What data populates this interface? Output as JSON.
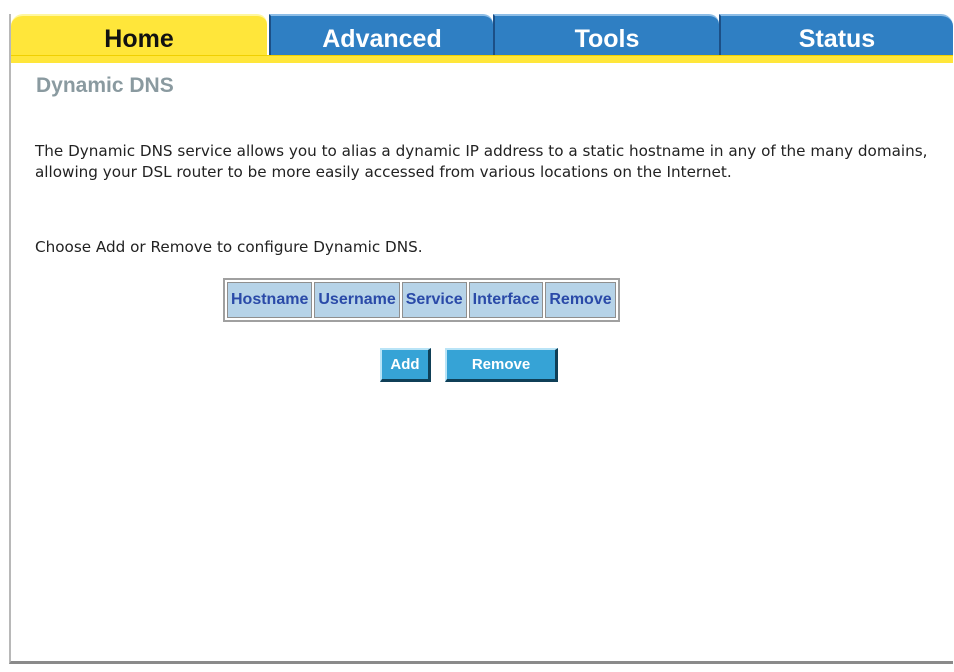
{
  "nav": {
    "tabs": [
      {
        "label": "Home",
        "active": true
      },
      {
        "label": "Advanced",
        "active": false
      },
      {
        "label": "Tools",
        "active": false
      },
      {
        "label": "Status",
        "active": false
      }
    ]
  },
  "page": {
    "title": "Dynamic DNS",
    "description": "The Dynamic DNS service allows you to alias a dynamic IP address to a static hostname in any of the many domains, allowing your DSL router to be more easily accessed from various locations on the Internet.",
    "instruction": "Choose Add or Remove to configure Dynamic DNS."
  },
  "table": {
    "columns": [
      "Hostname",
      "Username",
      "Service",
      "Interface",
      "Remove"
    ],
    "rows": []
  },
  "buttons": {
    "add_label": "Add",
    "remove_label": "Remove"
  },
  "colors": {
    "active_tab": "#ffe63a",
    "inactive_tab": "#2f7fc3",
    "title_text": "#8a9aa0",
    "table_header_bg": "#b6d3e8",
    "table_header_text": "#2a4aa8",
    "button_bg": "#36a3d6"
  }
}
